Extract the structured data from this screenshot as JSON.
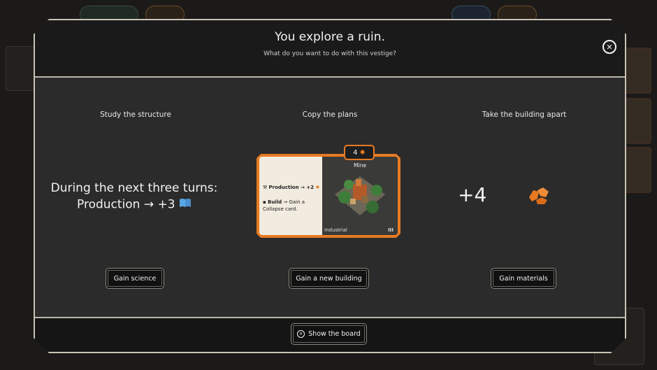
{
  "modal": {
    "title": "You explore a ruin.",
    "subtitle": "What do you want to do with this vestige?",
    "close_icon": "close-icon"
  },
  "options": {
    "science": {
      "title": "Study the structure",
      "line1": "During the next three turns:",
      "line2": "Production → +3",
      "icon": "book-icon",
      "button": "Gain science"
    },
    "building": {
      "title": "Copy the plans",
      "button": "Gain a new building",
      "card": {
        "cost": "4",
        "cost_icon": "materials-icon",
        "name": "Mine",
        "production": "Production → +2",
        "build": "Build",
        "build_effect": "→ Gain a Collapse card.",
        "type": "Industrial",
        "tier": "III"
      }
    },
    "materials": {
      "title": "Take the building apart",
      "amount": "+4",
      "icon": "materials-icon",
      "button": "Gain materials"
    }
  },
  "footer": {
    "show_board": "Show the board",
    "show_board_icon": "circle-x-icon"
  },
  "colors": {
    "accent": "#e87a22",
    "science": "#5aa6e6",
    "panel": "#2b2b2b"
  }
}
